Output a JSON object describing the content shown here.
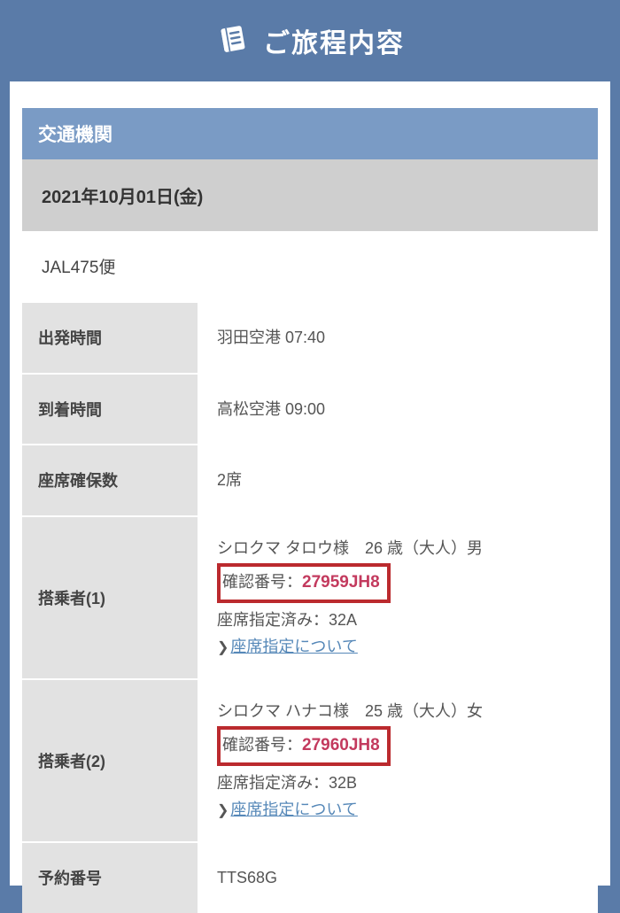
{
  "header": {
    "title": "ご旅程内容"
  },
  "section": {
    "transport": "交通機関"
  },
  "date": "2021年10月01日(金)",
  "flight": "JAL475便",
  "labels": {
    "departure": "出発時間",
    "arrival": "到着時間",
    "seats": "座席確保数",
    "pax1": "搭乗者(1)",
    "pax2": "搭乗者(2)",
    "booking": "予約番号"
  },
  "values": {
    "departure": "羽田空港 07:40",
    "arrival": "高松空港 09:00",
    "seats": "2席",
    "booking": "TTS68G"
  },
  "pax1": {
    "name_line": "シロクマ タロウ様　26 歳（大人）男",
    "confirm_label": "確認番号：",
    "confirm_number": "27959JH8",
    "seat_line": "座席指定済み：32A",
    "seat_link": "座席指定について"
  },
  "pax2": {
    "name_line": "シロクマ ハナコ様　25 歳（大人）女",
    "confirm_label": "確認番号：",
    "confirm_number": "27960JH8",
    "seat_line": "座席指定済み：32B",
    "seat_link": "座席指定について"
  }
}
